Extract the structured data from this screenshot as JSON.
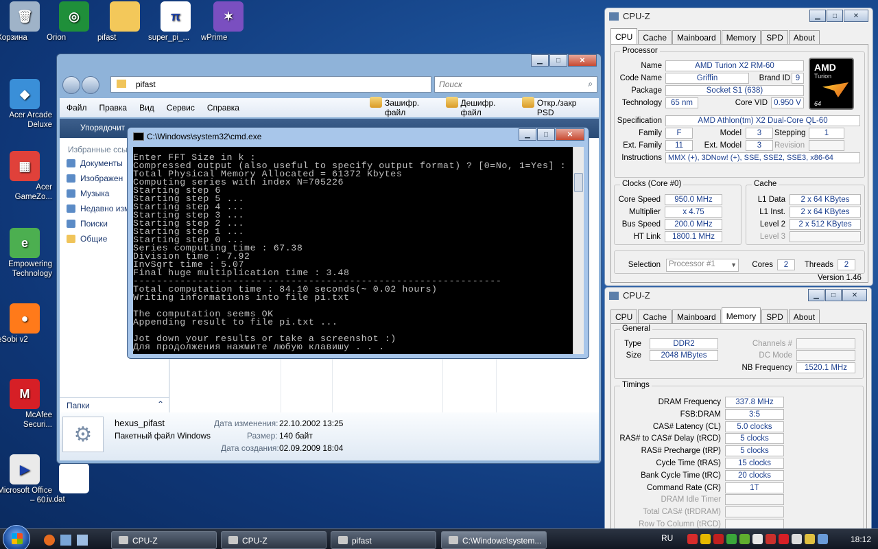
{
  "desktop_icons": [
    {
      "label": "Корзина",
      "icon": "recycle-bin-icon",
      "glyph": "🗑",
      "color": "#9fb3c8"
    },
    {
      "label": "Orion",
      "icon": "orion-icon",
      "glyph": "◎",
      "color": "#1f8f3a"
    },
    {
      "label": "pifast",
      "icon": "folder-icon",
      "glyph": "",
      "color": "#f3c85a"
    },
    {
      "label": "super_pi_...",
      "icon": "superpi-icon",
      "glyph": "π",
      "color": "#ffffff"
    },
    {
      "label": "wPrime",
      "icon": "wprime-icon",
      "glyph": "✶",
      "color": "#7a4fc0"
    },
    {
      "label": "Acer Arcade Deluxe",
      "icon": "acer-arcade-icon",
      "glyph": "◆",
      "color": "#3a8fd8"
    },
    {
      "label": "Acer GameZo...",
      "icon": "acer-gamezone-icon",
      "glyph": "▦",
      "color": "#e0413a"
    },
    {
      "label": "Empowering Technology",
      "icon": "empowering-icon",
      "glyph": "e",
      "color": "#4caf50"
    },
    {
      "label": "eSobi v2",
      "icon": "esobi-icon",
      "glyph": "●",
      "color": "#ff7a1a"
    },
    {
      "label": "McAfee Securi...",
      "icon": "mcafee-icon",
      "glyph": "M",
      "color": "#d61f26"
    },
    {
      "label": "Microsoft Office – 60...",
      "icon": "ms-office-icon",
      "glyph": "▶",
      "color": "#eaeaea"
    },
    {
      "label": "iv.dat",
      "icon": "file-icon",
      "glyph": "",
      "color": "#ffffff"
    }
  ],
  "explorer": {
    "address": "pifast",
    "search_placeholder": "Поиск",
    "menu": [
      "Файл",
      "Правка",
      "Вид",
      "Сервис",
      "Справка"
    ],
    "tools": [
      "Зашифр. файл",
      "Дешифр. файл",
      "Откр./закр PSD"
    ],
    "organize": "Упорядочит",
    "favorites_header": "Избранные ссы",
    "nav_items": [
      "Документы",
      "Изображен",
      "Музыка",
      "Недавно изм",
      "Поиски",
      "Общие"
    ],
    "folders_label": "Папки",
    "details": {
      "name": "hexus_pifast",
      "type": "Пакетный файл Windows",
      "modified_label": "Дата изменения:",
      "modified_value": "22.10.2002 13:25",
      "size_label": "Размер:",
      "size_value": "140 байт",
      "created_label": "Дата создания:",
      "created_value": "02.09.2009 18:04"
    }
  },
  "cmd": {
    "title": "C:\\Windows\\system32\\cmd.exe",
    "lines": [
      "Enter FFT Size in k :",
      "Compressed output (also useful to specify output format) ? [0=No, 1=Yes] :",
      "Total Physical Memory Allocated = 61372 Kbytes",
      "Computing series with index N=705226",
      "Starting step 6",
      "Starting step 5 ...",
      "Starting step 4 ...",
      "Starting step 3 ...",
      "Starting step 2 ...",
      "Starting step 1 ...",
      "Starting step 0 ...",
      "Series computing time : 67.38",
      "Division time : 7.92",
      "InvSqrt time : 5.07",
      "Final huge multiplication time : 3.48",
      "---------------------------------------------------------------",
      "Total computation time : 84.10 seconds(~ 0.02 hours)",
      "Writing informations into file pi.txt",
      "",
      "The computation seems OK",
      "Appending result to file pi.txt ...",
      "",
      "Jot down your results or take a screenshot :)",
      "Для продолжения нажмите любую клавишу . . ."
    ]
  },
  "cpuz1": {
    "title": "CPU-Z",
    "tabs": [
      "CPU",
      "Cache",
      "Mainboard",
      "Memory",
      "SPD",
      "About"
    ],
    "active_tab": "CPU",
    "processor_group": "Processor",
    "name_label": "Name",
    "name": "AMD Turion X2 RM-60",
    "codename_label": "Code Name",
    "codename": "Griffin",
    "brandid_label": "Brand ID",
    "brandid": "9",
    "package_label": "Package",
    "package": "Socket S1 (638)",
    "technology_label": "Technology",
    "technology": "65 nm",
    "corevid_label": "Core VID",
    "corevid": "0.950 V",
    "spec_label": "Specification",
    "spec": "AMD Athlon(tm) X2 Dual-Core QL-60",
    "family_label": "Family",
    "family": "F",
    "model_label": "Model",
    "model": "3",
    "stepping_label": "Stepping",
    "stepping": "1",
    "extfamily_label": "Ext. Family",
    "extfamily": "11",
    "extmodel_label": "Ext. Model",
    "extmodel": "3",
    "revision_label": "Revision",
    "instructions_label": "Instructions",
    "instructions": "MMX (+), 3DNow! (+), SSE, SSE2, SSE3, x86-64",
    "clocks_group": "Clocks (Core #0)",
    "corespeed_label": "Core Speed",
    "corespeed": "950.0 MHz",
    "multiplier_label": "Multiplier",
    "multiplier": "x 4.75",
    "busspeed_label": "Bus Speed",
    "busspeed": "200.0 MHz",
    "htlink_label": "HT Link",
    "htlink": "1800.1 MHz",
    "cache_group": "Cache",
    "l1data_label": "L1 Data",
    "l1data": "2 x 64 KBytes",
    "l1inst_label": "L1 Inst.",
    "l1inst": "2 x 64 KBytes",
    "l2_label": "Level 2",
    "l2": "2 x 512 KBytes",
    "l3_label": "Level 3",
    "selection_label": "Selection",
    "selection": "Processor #1",
    "cores_label": "Cores",
    "cores": "2",
    "threads_label": "Threads",
    "threads": "2",
    "version": "Version 1.46",
    "logo_brand": "AMD",
    "logo_line": "Turion",
    "logo_sub": "64"
  },
  "cpuz2": {
    "title": "CPU-Z",
    "tabs": [
      "CPU",
      "Cache",
      "Mainboard",
      "Memory",
      "SPD",
      "About"
    ],
    "active_tab": "Memory",
    "general_group": "General",
    "type_label": "Type",
    "type": "DDR2",
    "size_label": "Size",
    "size": "2048 MBytes",
    "channels_label": "Channels #",
    "dcmode_label": "DC Mode",
    "nbfreq_label": "NB Frequency",
    "nbfreq": "1520.1 MHz",
    "timings_group": "Timings",
    "timings": [
      {
        "label": "DRAM Frequency",
        "value": "337.8 MHz"
      },
      {
        "label": "FSB:DRAM",
        "value": "3:5"
      },
      {
        "label": "CAS# Latency (CL)",
        "value": "5.0 clocks"
      },
      {
        "label": "RAS# to CAS# Delay (tRCD)",
        "value": "5 clocks"
      },
      {
        "label": "RAS# Precharge (tRP)",
        "value": "5 clocks"
      },
      {
        "label": "Cycle Time (tRAS)",
        "value": "15 clocks"
      },
      {
        "label": "Bank Cycle Time (tRC)",
        "value": "20 clocks"
      },
      {
        "label": "Command Rate (CR)",
        "value": "1T"
      },
      {
        "label": "DRAM Idle Timer",
        "value": ""
      },
      {
        "label": "Total CAS# (tRDRAM)",
        "value": ""
      },
      {
        "label": "Row To Column (tRCD)",
        "value": ""
      }
    ]
  },
  "taskbar": {
    "buttons": [
      "CPU-Z",
      "CPU-Z",
      "pifast",
      "C:\\Windows\\system..."
    ],
    "active_index": 3,
    "language": "RU",
    "clock": "18:12"
  }
}
